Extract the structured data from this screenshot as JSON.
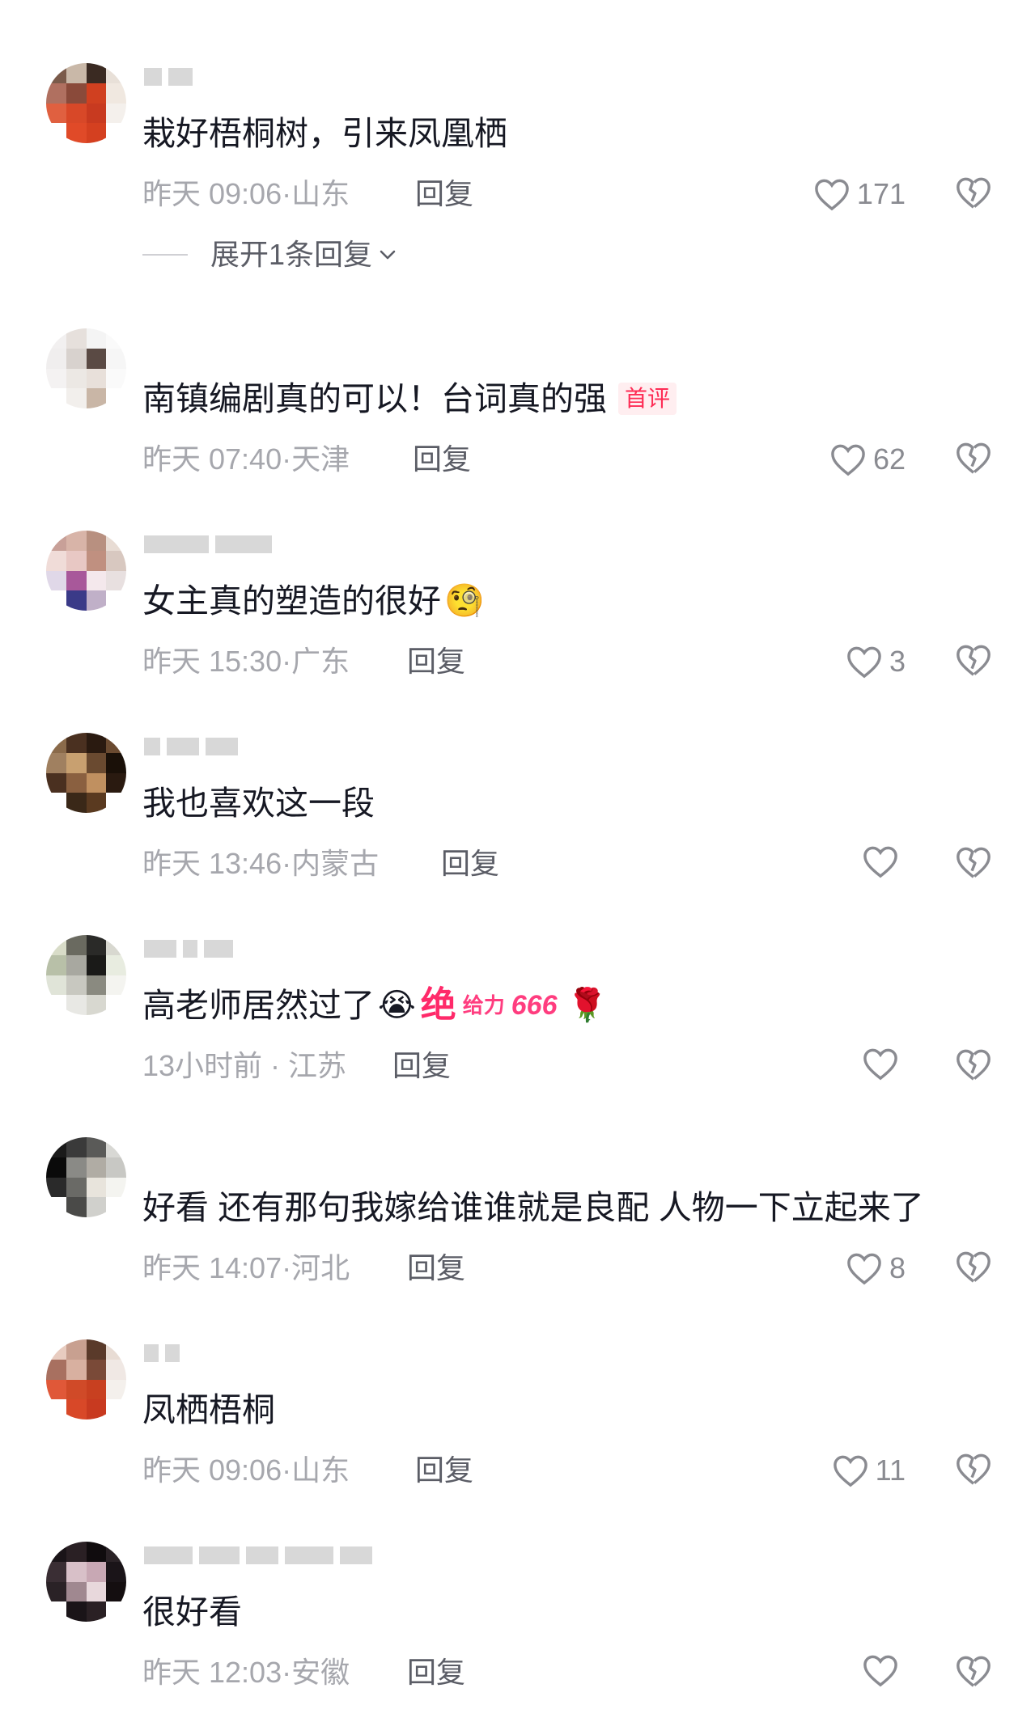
{
  "comments": [
    {
      "text": "栽好梧桐树，引来凤凰栖",
      "time": "昨天 09:06",
      "location": "山东",
      "reply_label": "回复",
      "likes": "171",
      "expand_label": "展开1条回复"
    },
    {
      "text": "南镇编剧真的可以！台词真的强",
      "tag": "首评",
      "time": "昨天 07:40",
      "location": "天津",
      "reply_label": "回复",
      "likes": "62"
    },
    {
      "text": "女主真的塑造的很好",
      "emoji": "🧐",
      "time": "昨天 15:30",
      "location": "广东",
      "reply_label": "回复",
      "likes": "3"
    },
    {
      "text": "我也喜欢这一段",
      "time": "昨天 13:46",
      "location": "内蒙古",
      "reply_label": "回复",
      "likes": ""
    },
    {
      "text": "高老师居然过了",
      "emoji": "😭",
      "sticker_jue": "绝",
      "sticker_geili": "给力",
      "sticker_666": "666",
      "emoji_rose": "🌹",
      "time": "13小时前",
      "location": "江苏",
      "reply_label": "回复",
      "likes": ""
    },
    {
      "text": "好看 还有那句我嫁给谁谁就是良配 人物一下立起来了",
      "time": "昨天 14:07",
      "location": "河北",
      "reply_label": "回复",
      "likes": "8"
    },
    {
      "text": "凤栖梧桐",
      "time": "昨天 09:06",
      "location": "山东",
      "reply_label": "回复",
      "likes": "11"
    },
    {
      "text": "很好看",
      "time": "昨天 12:03",
      "location": "安徽",
      "reply_label": "回复",
      "likes": ""
    }
  ],
  "icons": {
    "like": "heart-outline-icon",
    "dislike": "broken-heart-icon",
    "expand": "chevron-down-icon"
  },
  "colors": {
    "text": "#161823",
    "meta": "#a6a7ad",
    "reply": "#5b5d66",
    "tag_bg": "#ffeef0",
    "tag_fg": "#fe2c55"
  }
}
